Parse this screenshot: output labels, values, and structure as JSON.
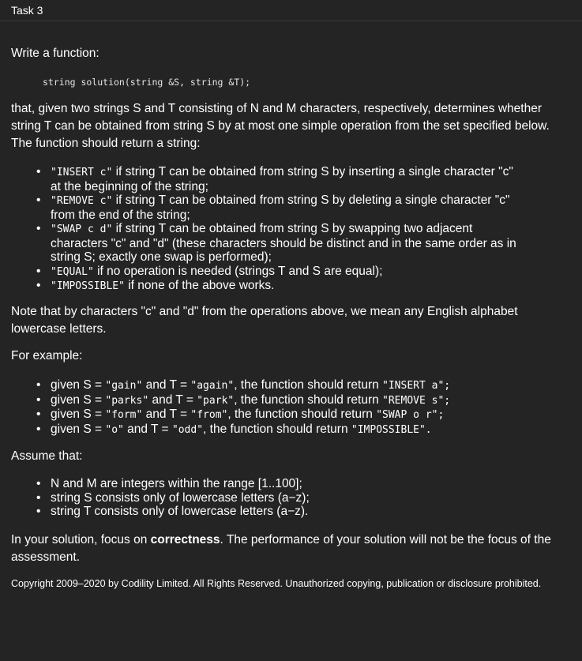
{
  "header": {
    "title": "Task 3"
  },
  "intro": "Write a function:",
  "signature": "string solution(string &S, string &T);",
  "description": [
    "that, given two strings S and T consisting of N and M characters, respectively, determines whether",
    "string T can be obtained from string S by at most one simple operation from the set specified below.",
    "The function should return a string:"
  ],
  "rules": [
    {
      "code": "\"INSERT c\"",
      "lines": [
        " if string T can be obtained from string S by inserting a single character \"c\"",
        "at the beginning of the string;"
      ]
    },
    {
      "code": "\"REMOVE c\"",
      "lines": [
        " if string T can be obtained from string S by deleting a single character \"c\"",
        "from the end of the string;"
      ]
    },
    {
      "code": "\"SWAP c d\"",
      "lines": [
        " if string T can be obtained from string S by swapping two adjacent",
        "characters \"c\" and \"d\" (these characters should be distinct and in the same order as in",
        "string S; exactly one swap is performed);"
      ]
    },
    {
      "code": "\"EQUAL\"",
      "lines": [
        " if no operation is needed (strings T and S are equal);"
      ]
    },
    {
      "code": "\"IMPOSSIBLE\"",
      "lines": [
        " if none of the above works."
      ]
    }
  ],
  "note": [
    "Note that by characters \"c\" and \"d\" from the operations above, we mean any English alphabet",
    "lowercase letters."
  ],
  "for_example": "For example:",
  "examples": [
    {
      "s": "\"gain\"",
      "t": "\"again\"",
      "ret": "\"INSERT a\";"
    },
    {
      "s": "\"parks\"",
      "t": "\"park\"",
      "ret": "\"REMOVE s\";"
    },
    {
      "s": "\"form\"",
      "t": "\"from\"",
      "ret": "\"SWAP o r\";"
    },
    {
      "s": "\"o\"",
      "t": "\"odd\"",
      "ret": "\"IMPOSSIBLE\"."
    }
  ],
  "example_parts": {
    "given_s": "given S = ",
    "and_t": " and T = ",
    "should_return": ", the function should return "
  },
  "assume_title": "Assume that:",
  "assumptions": [
    "N and M are integers within the range [1..100];",
    "string S consists only of lowercase letters (a−z);",
    "string T consists only of lowercase letters (a−z)."
  ],
  "focus": {
    "before": "In your solution, focus on ",
    "bold": "correctness",
    "after": ". The performance of your solution will not be the focus of the",
    "line2": "assessment."
  },
  "copyright": "Copyright 2009–2020 by Codility Limited. All Rights Reserved. Unauthorized copying, publication or disclosure prohibited.",
  "colors": {
    "background": "#242424",
    "text": "#ffffff",
    "divider": "#3a3a3a"
  }
}
